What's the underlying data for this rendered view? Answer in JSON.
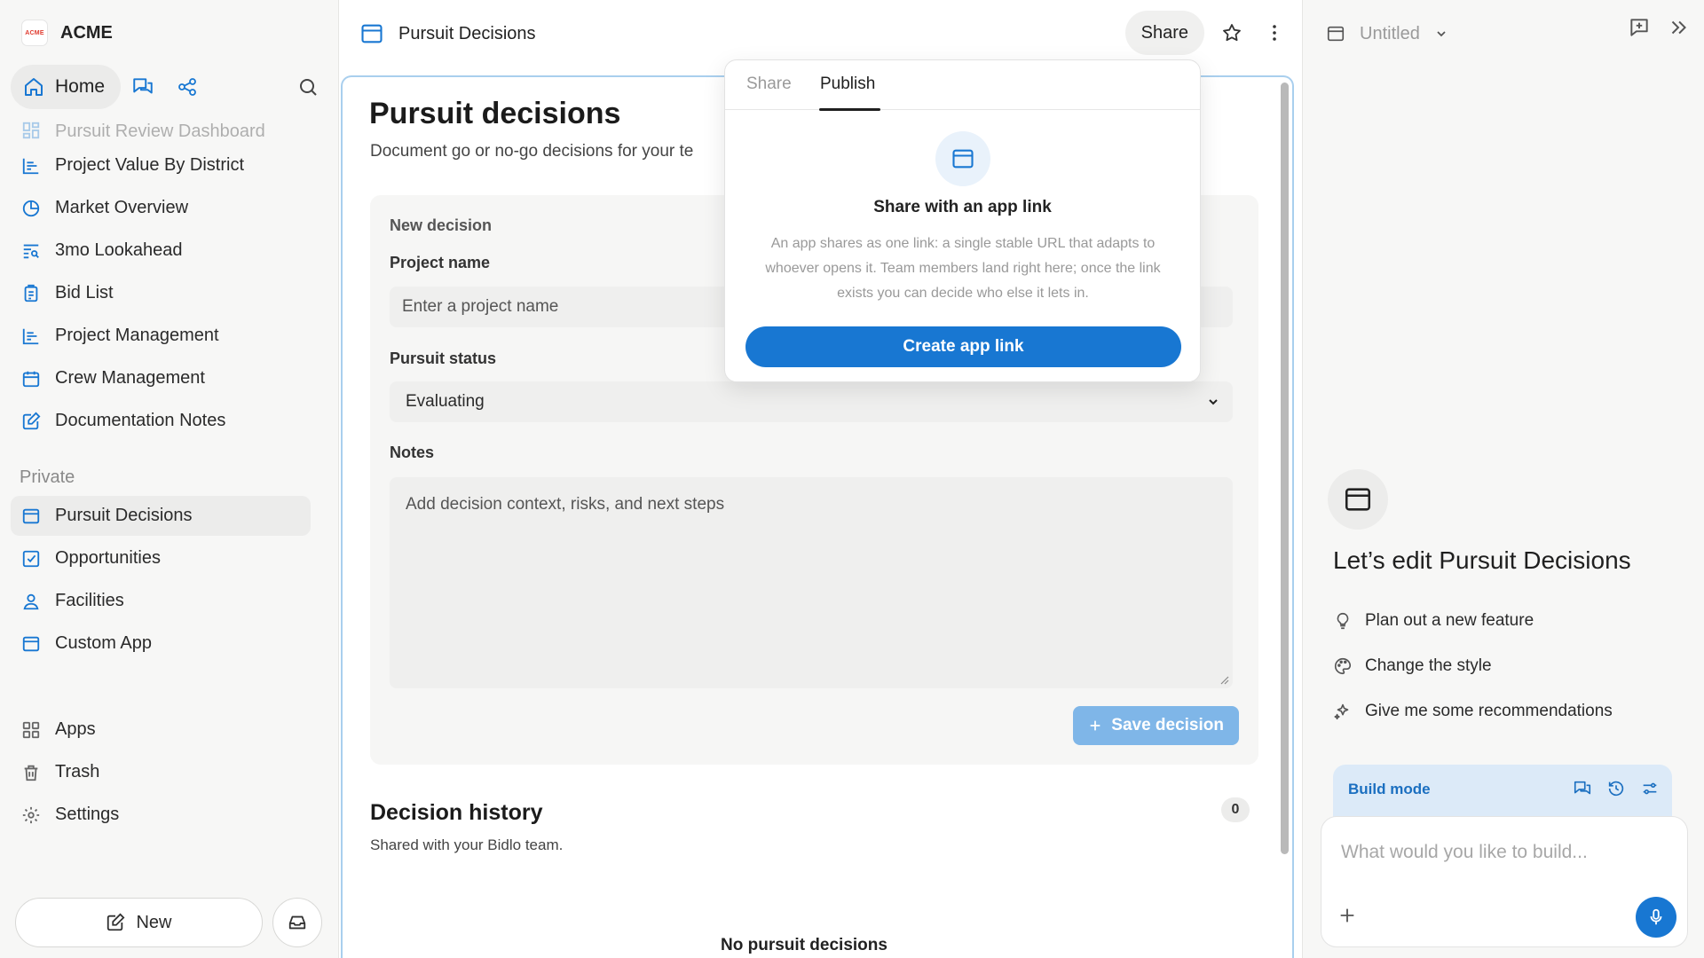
{
  "brand": {
    "logo_text": "ACME",
    "name": "ACME"
  },
  "topnav": {
    "home_label": "Home"
  },
  "sidebar": {
    "items": [
      {
        "label": "Pursuit Review Dashboard",
        "icon": "dashboard-icon"
      },
      {
        "label": "Project Value By District",
        "icon": "bar-chart-icon"
      },
      {
        "label": "Market Overview",
        "icon": "pie-chart-icon"
      },
      {
        "label": "3mo Lookahead",
        "icon": "list-search-icon"
      },
      {
        "label": "Bid List",
        "icon": "clipboard-icon"
      },
      {
        "label": "Project Management",
        "icon": "bar-chart-icon"
      },
      {
        "label": "Crew Management",
        "icon": "calendar-icon"
      },
      {
        "label": "Documentation Notes",
        "icon": "edit-note-icon"
      }
    ],
    "private_label": "Private",
    "private_items": [
      {
        "label": "Pursuit Decisions",
        "icon": "app-window-icon"
      },
      {
        "label": "Opportunities",
        "icon": "checkbox-icon"
      },
      {
        "label": "Facilities",
        "icon": "user-icon"
      },
      {
        "label": "Custom App",
        "icon": "app-window-icon"
      }
    ],
    "bottom_items": [
      {
        "label": "Apps",
        "icon": "grid-icon"
      },
      {
        "label": "Trash",
        "icon": "trash-icon"
      },
      {
        "label": "Settings",
        "icon": "gear-icon"
      }
    ],
    "new_label": "New"
  },
  "header": {
    "title": "Pursuit Decisions",
    "share_label": "Share"
  },
  "app": {
    "title": "Pursuit decisions",
    "subtitle": "Document go or no-go decisions for your te",
    "form": {
      "section_label": "New decision",
      "project_label": "Project name",
      "project_placeholder": "Enter a project name",
      "status_label": "Pursuit status",
      "status_value": "Evaluating",
      "notes_label": "Notes",
      "notes_placeholder": "Add decision context, risks, and next steps",
      "save_label": "Save decision"
    },
    "history": {
      "title": "Decision history",
      "subtitle": "Shared with your Bidlo team.",
      "count": "0",
      "empty": "No pursuit decisions"
    }
  },
  "popover": {
    "tabs": [
      "Share",
      "Publish"
    ],
    "active_tab": "Publish",
    "title": "Share with an app link",
    "description": "An app shares as one link: a single stable URL that adapts to whoever opens it. Team members land right here; once the link exists you can decide who else it lets in.",
    "button_label": "Create app link"
  },
  "panel": {
    "title": "Untitled",
    "heading": "Let’s edit Pursuit Decisions",
    "suggestions": [
      {
        "label": "Plan out a new feature",
        "icon": "lightbulb-icon"
      },
      {
        "label": "Change the style",
        "icon": "palette-icon"
      },
      {
        "label": "Give me some recommendations",
        "icon": "sparkles-icon"
      }
    ],
    "mode_label": "Build mode",
    "composer_placeholder": "What would you like to build..."
  },
  "colors": {
    "accent": "#1877d2",
    "frame_border": "#a9cfee",
    "save_disabled": "#7fb6e8",
    "logo_red": "#e03b2f"
  }
}
